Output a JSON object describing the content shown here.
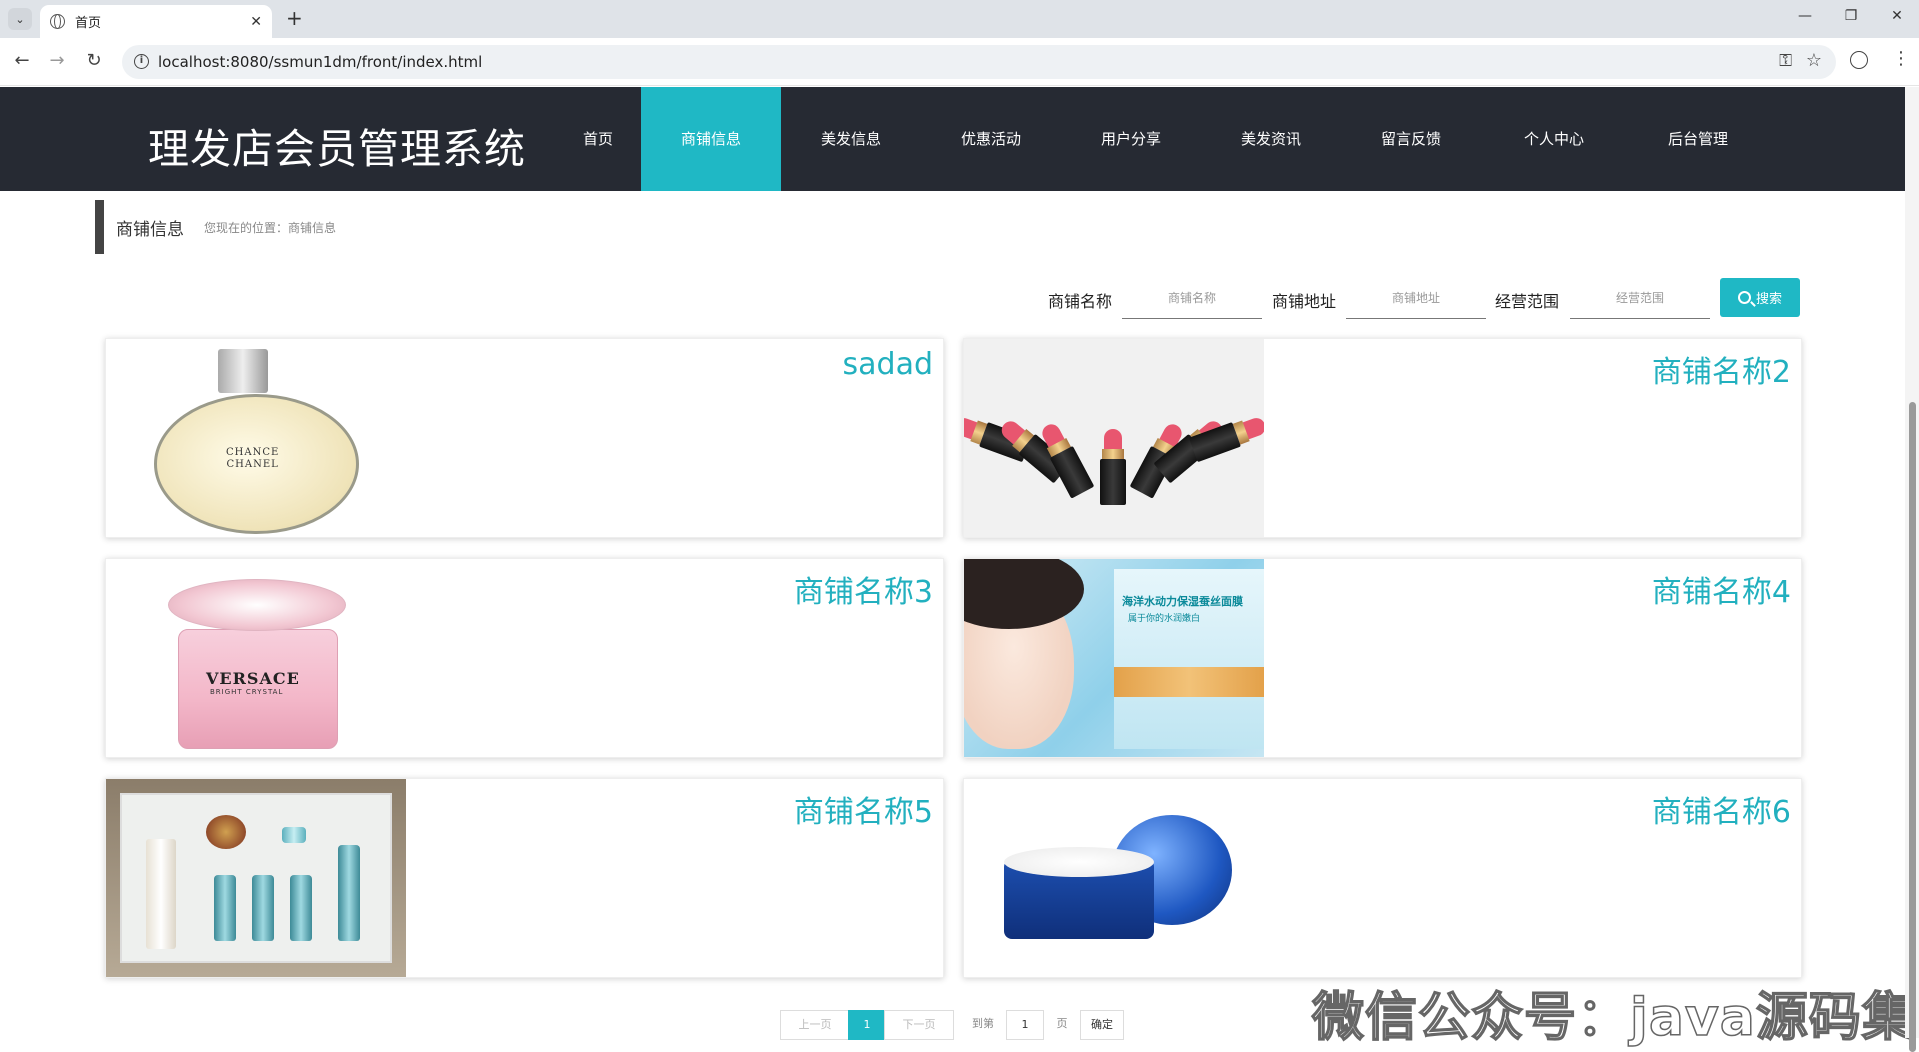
{
  "browser": {
    "tab_title": "首页",
    "url": "localhost:8080/ssmun1dm/front/index.html"
  },
  "site": {
    "title": "理发店会员管理系统",
    "nav": [
      "首页",
      "商铺信息",
      "美发信息",
      "优惠活动",
      "用户分享",
      "美发资讯",
      "留言反馈",
      "个人中心",
      "后台管理"
    ],
    "active_nav": "商铺信息"
  },
  "breadcrumb": {
    "title": "商铺信息",
    "position": "您现在的位置：商铺信息"
  },
  "search": {
    "name_label": "商铺名称",
    "name_placeholder": "商铺名称",
    "address_label": "商铺地址",
    "address_placeholder": "商铺地址",
    "scope_label": "经营范围",
    "scope_placeholder": "经营范围",
    "button": "搜索"
  },
  "shops": [
    {
      "name": "sadad",
      "image": "chanel-perfume"
    },
    {
      "name": "商铺名称2",
      "image": "lipsticks"
    },
    {
      "name": "商铺名称3",
      "image": "versace-perfume"
    },
    {
      "name": "商铺名称4",
      "image": "face-mask"
    },
    {
      "name": "商铺名称5",
      "image": "skincare-set"
    },
    {
      "name": "商铺名称6",
      "image": "cream-jar"
    }
  ],
  "product_text": {
    "chanel_line1": "CHANCE",
    "chanel_line2": "CHANEL",
    "versace": "VERSACE",
    "versace_sub": "BRIGHT CRYSTAL",
    "mask_title": "海洋水动力保湿蚕丝面膜",
    "mask_sub": "属于你的水润嫩白"
  },
  "pagination": {
    "prev": "上一页",
    "current": "1",
    "next": "下一页",
    "goto": "到第",
    "goto_value": "1",
    "page_unit": "页",
    "confirm": "确定"
  },
  "watermark": "微信公众号：java源码集合",
  "colors": {
    "accent": "#1fb8c5",
    "header_bg": "#262a33",
    "shop_name": "#22b0bf"
  }
}
